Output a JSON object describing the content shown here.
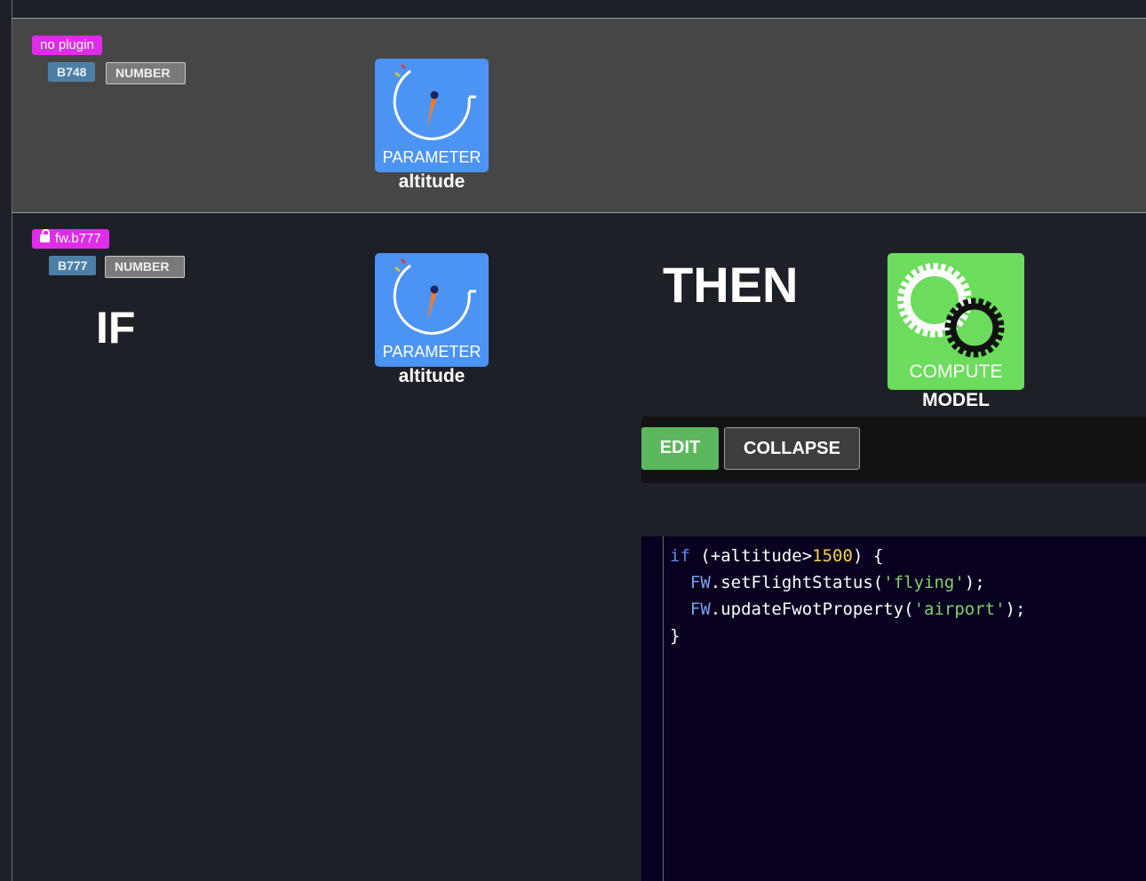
{
  "rows": [
    {
      "plugin_tag": "no plugin",
      "locked": false,
      "model_badge": "B748",
      "type_badge": "NUMBER",
      "parameter": {
        "tile_label": "PARAMETER",
        "caption": "altitude"
      }
    },
    {
      "plugin_tag": "fw.b777",
      "locked": true,
      "model_badge": "B777",
      "type_badge": "NUMBER",
      "if_label": "IF",
      "then_label": "THEN",
      "parameter": {
        "tile_label": "PARAMETER",
        "caption": "altitude"
      },
      "compute": {
        "tile_label": "COMPUTE",
        "caption": "MODEL"
      },
      "buttons": {
        "edit": "EDIT",
        "collapse": "COLLAPSE"
      },
      "code": {
        "line1": {
          "kw": "if",
          "pre": " (+altitude>",
          "num": "1500",
          "post": ") {"
        },
        "line2": {
          "obj": "FW",
          "call": ".setFlightStatus(",
          "str": "'flying'",
          "end": ");"
        },
        "line3": {
          "obj": "FW",
          "call": ".updateFwotProperty(",
          "str": "'airport'",
          "end": ");"
        },
        "line4": "}"
      }
    }
  ],
  "colors": {
    "background": "#1e2028",
    "row_highlight": "#464646",
    "plugin_tag": "#e02ce8",
    "model_badge": "#4d7fa6",
    "parameter_tile": "#4c94f4",
    "compute_tile": "#6bdc5b",
    "edit_button": "#5cb85c",
    "code_background": "#09001f"
  },
  "icons": [
    "gauge-icon",
    "gears-icon",
    "lock-icon"
  ]
}
